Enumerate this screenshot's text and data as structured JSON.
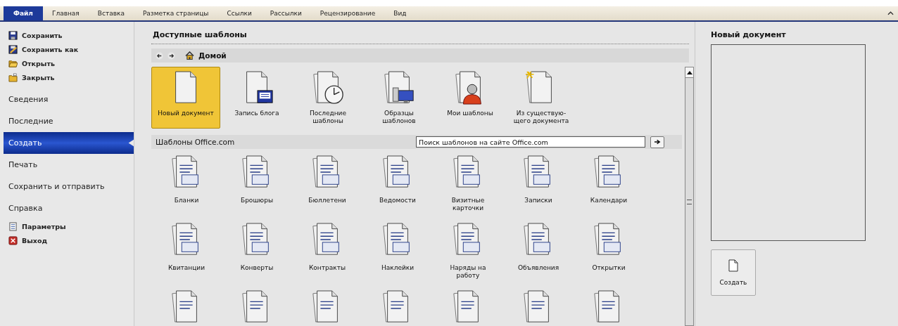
{
  "ribbon": {
    "tabs": [
      {
        "label": "Файл",
        "selected": true
      },
      {
        "label": "Главная",
        "selected": false
      },
      {
        "label": "Вставка",
        "selected": false
      },
      {
        "label": "Разметка страницы",
        "selected": false
      },
      {
        "label": "Ссылки",
        "selected": false
      },
      {
        "label": "Рассылки",
        "selected": false
      },
      {
        "label": "Рецензирование",
        "selected": false
      },
      {
        "label": "Вид",
        "selected": false
      }
    ]
  },
  "sidebar": {
    "items": [
      {
        "label": "Сохранить",
        "kind": "command",
        "selected": false
      },
      {
        "label": "Сохранить как",
        "kind": "command",
        "selected": false
      },
      {
        "label": "Открыть",
        "kind": "command",
        "selected": false
      },
      {
        "label": "Закрыть",
        "kind": "command",
        "selected": false
      },
      {
        "label": "Сведения",
        "kind": "section",
        "selected": false
      },
      {
        "label": "Последние",
        "kind": "section",
        "selected": false
      },
      {
        "label": "Создать",
        "kind": "section",
        "selected": true
      },
      {
        "label": "Печать",
        "kind": "section",
        "selected": false
      },
      {
        "label": "Сохранить и отправить",
        "kind": "section",
        "selected": false
      },
      {
        "label": "Справка",
        "kind": "section",
        "selected": false
      },
      {
        "label": "Параметры",
        "kind": "command",
        "selected": false
      },
      {
        "label": "Выход",
        "kind": "command",
        "selected": false
      }
    ]
  },
  "templates": {
    "title": "Доступные шаблоны",
    "nav": {
      "home": "Домой"
    },
    "items": [
      {
        "label": "Новый документ",
        "kind": "blank",
        "selected": true
      },
      {
        "label": "Запись блога",
        "kind": "blog",
        "selected": false
      },
      {
        "label": "Последние шаблоны",
        "kind": "recent",
        "selected": false
      },
      {
        "label": "Образцы шаблонов",
        "kind": "samples",
        "selected": false
      },
      {
        "label": "Мои шаблоны",
        "kind": "mine",
        "selected": false
      },
      {
        "label": "Из существую-щего документа",
        "kind": "existing",
        "selected": false
      }
    ],
    "office": {
      "title": "Шаблоны Office.com",
      "search": {
        "placeholder": "Поиск шаблонов на сайте Office.com"
      },
      "categories": [
        "Бланки",
        "Брошюры",
        "Бюллетени",
        "Ведомости",
        "Визитные карточки",
        "Записки",
        "Календари",
        "Квитанции",
        "Конверты",
        "Контракты",
        "Наклейки",
        "Наряды на работу",
        "Объявления",
        "Открытки"
      ]
    }
  },
  "preview": {
    "title": "Новый документ",
    "button": "Создать"
  }
}
